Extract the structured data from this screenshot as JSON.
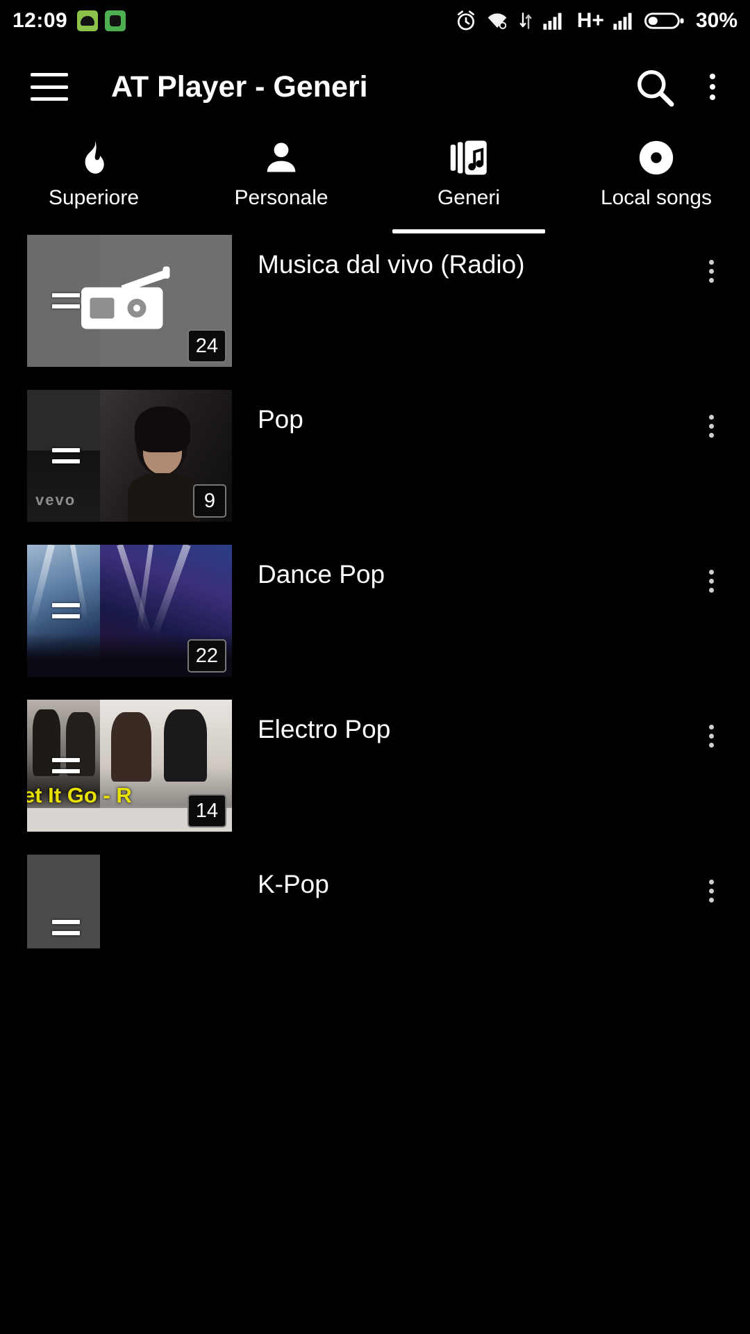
{
  "status_bar": {
    "clock": "12:09",
    "battery_percent": "30%",
    "network_type": "H+",
    "icons": [
      "android-icon",
      "green-app-icon",
      "alarm-icon",
      "wifi-icon",
      "data-transfer-icon",
      "signal-1-icon",
      "signal-2-icon",
      "battery-icon"
    ]
  },
  "app_bar": {
    "menu_icon": "hamburger-menu-icon",
    "title": "AT Player - Generi",
    "search_icon": "search-icon",
    "overflow_icon": "overflow-menu-icon"
  },
  "tabs": [
    {
      "label": "Superiore",
      "icon": "flame-icon",
      "active": false
    },
    {
      "label": "Personale",
      "icon": "person-icon",
      "active": false
    },
    {
      "label": "Generi",
      "icon": "music-library-icon",
      "active": true
    },
    {
      "label": "Local songs",
      "icon": "disc-icon",
      "active": false
    }
  ],
  "list": [
    {
      "title": "Musica dal vivo (Radio)",
      "count": "24",
      "art": "radio",
      "menu_icon": "row-overflow-icon",
      "drag_icon": "drag-handle-icon"
    },
    {
      "title": "Pop",
      "count": "9",
      "art": "pop",
      "menu_icon": "row-overflow-icon",
      "drag_icon": "drag-handle-icon",
      "watermark": "vevo"
    },
    {
      "title": "Dance Pop",
      "count": "22",
      "art": "dance",
      "menu_icon": "row-overflow-icon",
      "drag_icon": "drag-handle-icon"
    },
    {
      "title": "Electro Pop",
      "count": "14",
      "art": "electro",
      "menu_icon": "row-overflow-icon",
      "drag_icon": "drag-handle-icon",
      "overlay_text": "et It Go  -  R"
    },
    {
      "title": "K-Pop",
      "count": "",
      "art": "kpop",
      "menu_icon": "row-overflow-icon",
      "drag_icon": "drag-handle-icon"
    }
  ],
  "colors": {
    "background": "#000000",
    "text": "#ffffff",
    "accent": "#ffffff",
    "badge_border": "#777777"
  }
}
